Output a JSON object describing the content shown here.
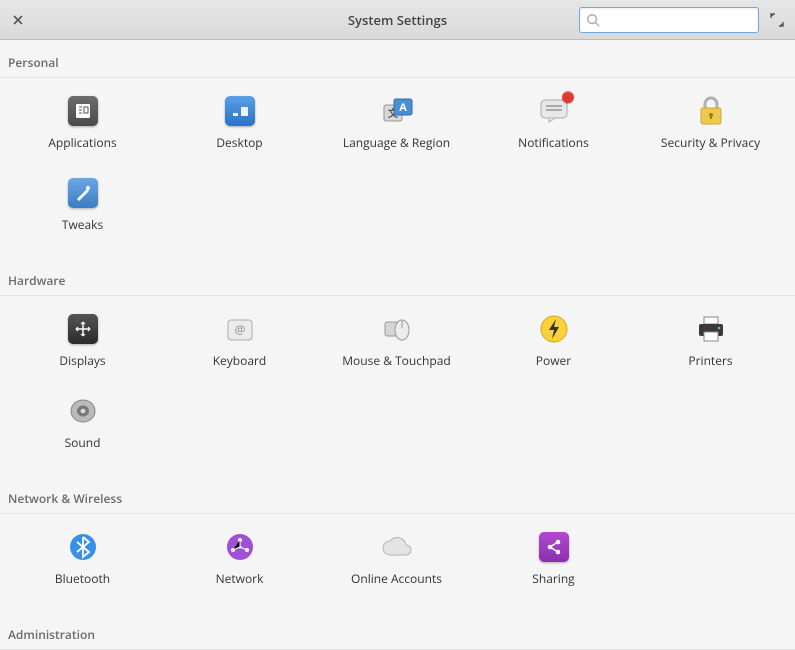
{
  "window": {
    "title": "System Settings"
  },
  "search": {
    "value": "",
    "placeholder": ""
  },
  "sections": {
    "personal": {
      "header": "Personal",
      "items": {
        "applications": "Applications",
        "desktop": "Desktop",
        "language_region": "Language & Region",
        "notifications": "Notifications",
        "security_privacy": "Security & Privacy",
        "tweaks": "Tweaks"
      }
    },
    "hardware": {
      "header": "Hardware",
      "items": {
        "displays": "Displays",
        "keyboard": "Keyboard",
        "mouse_touchpad": "Mouse & Touchpad",
        "power": "Power",
        "printers": "Printers",
        "sound": "Sound"
      }
    },
    "network": {
      "header": "Network & Wireless",
      "items": {
        "bluetooth": "Bluetooth",
        "network": "Network",
        "online_accounts": "Online Accounts",
        "sharing": "Sharing"
      }
    },
    "administration": {
      "header": "Administration"
    }
  },
  "colors": {
    "accent": "#6fa8dc",
    "notification_badge": "#e23a2e"
  }
}
